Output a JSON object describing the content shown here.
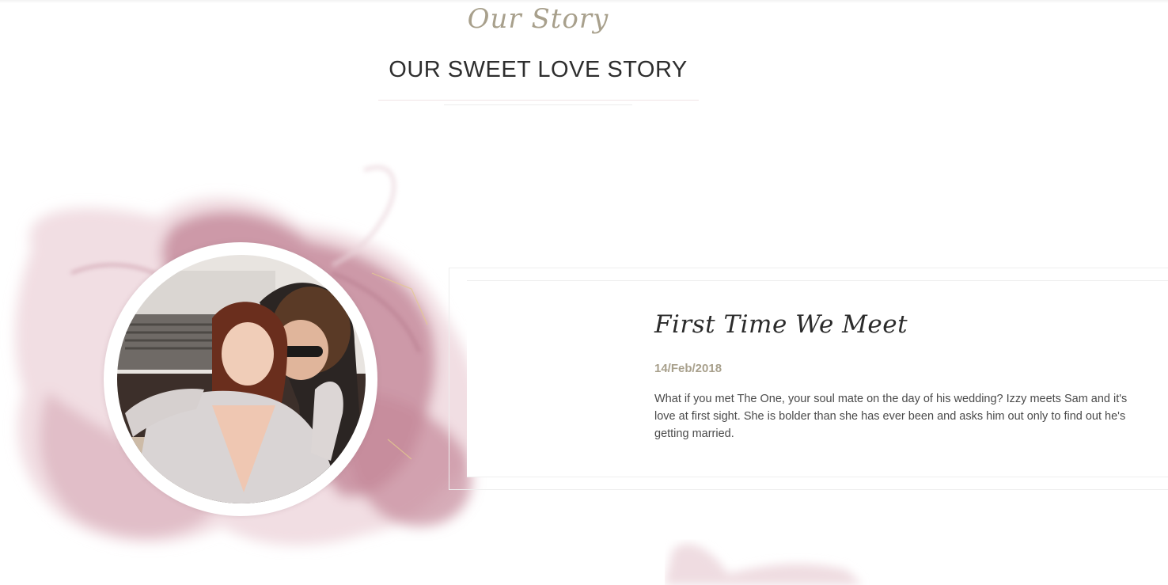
{
  "section": {
    "subtitle": "Our Story",
    "title": "OUR SWEET LOVE STORY"
  },
  "story": {
    "heading": "First Time We Meet",
    "date": "14/Feb/2018",
    "text": "What if you met The One, your soul mate on the day of his wedding? Izzy meets Sam and it's love at first sight. She is bolder than she has ever been and asks him out only to find out he's getting married."
  },
  "colors": {
    "accent": "#a8a08c",
    "splash": "#c98ea0",
    "heading": "#2e2e2e"
  },
  "icons": {
    "photo": "couple-photo"
  }
}
